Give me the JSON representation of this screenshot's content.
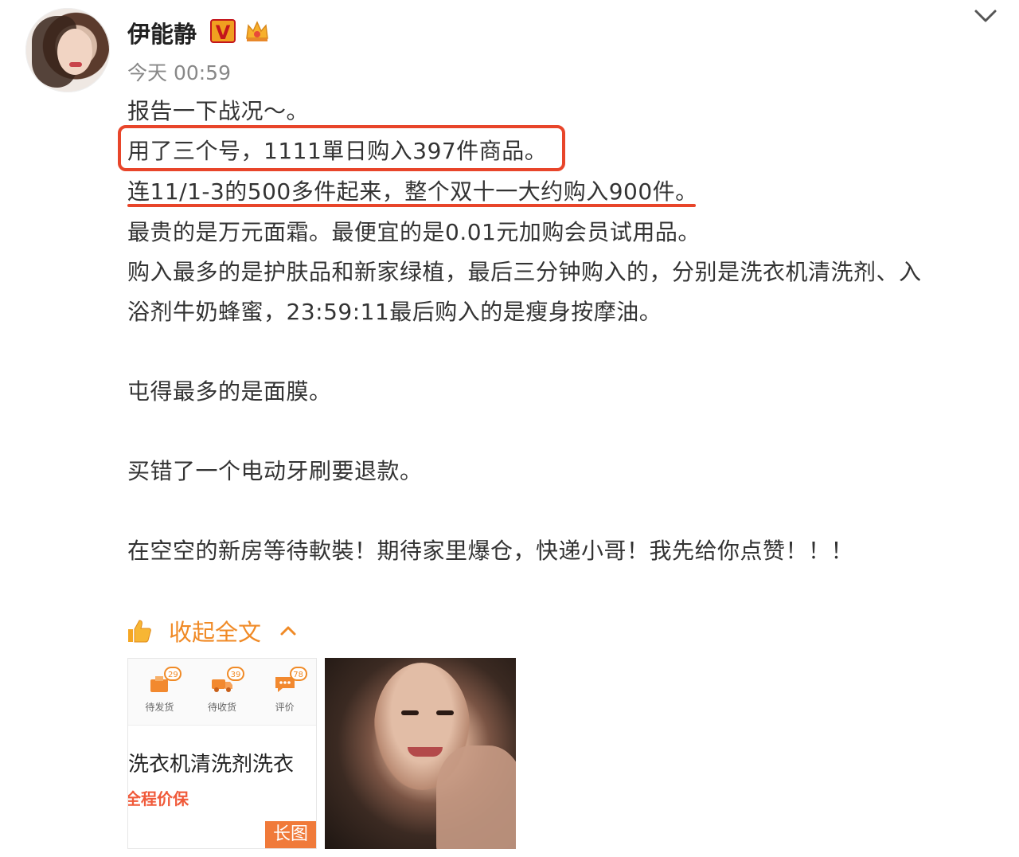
{
  "post": {
    "author": "伊能静",
    "verified_badge": "V",
    "time": "今天 00:59",
    "lines": [
      "报告一下战况～。",
      "用了三个号，1111單日购入397件商品。",
      "连11/1-3的500多件起来，整个双十一大约购入900件。",
      "最贵的是万元面霜。最便宜的是0.01元加购会员试用品。",
      "购入最多的是护肤品和新家绿植，最后三分钟购入的，分别是洗衣机清洗剂、入",
      "浴剂牛奶蜂蜜，23:59:11最后购入的是瘦身按摩油。",
      "屯得最多的是面膜。",
      "买错了一个电动牙刷要退款。",
      "在空空的新房等待軟裝！期待家里爆仓，快递小哥！我先给你点赞！！！"
    ],
    "collapse_label": "收起全文"
  },
  "attachments": {
    "order_tabs": [
      {
        "label": "待发货",
        "badge": "29"
      },
      {
        "label": "待收货",
        "badge": "39"
      },
      {
        "label": "评价",
        "badge": "78"
      }
    ],
    "product_title": "洗衣机清洗剂洗衣",
    "guarantee": "全程价保",
    "long_image_tag": "长图"
  },
  "colors": {
    "accent_orange": "#f08a26",
    "highlight_red": "#e8452a",
    "text": "#333333",
    "muted": "#888888"
  },
  "icons": [
    "avatar",
    "verified-v-icon",
    "crown-icon",
    "chevron-down-icon",
    "thumbs-up-icon",
    "chevron-up-icon"
  ]
}
